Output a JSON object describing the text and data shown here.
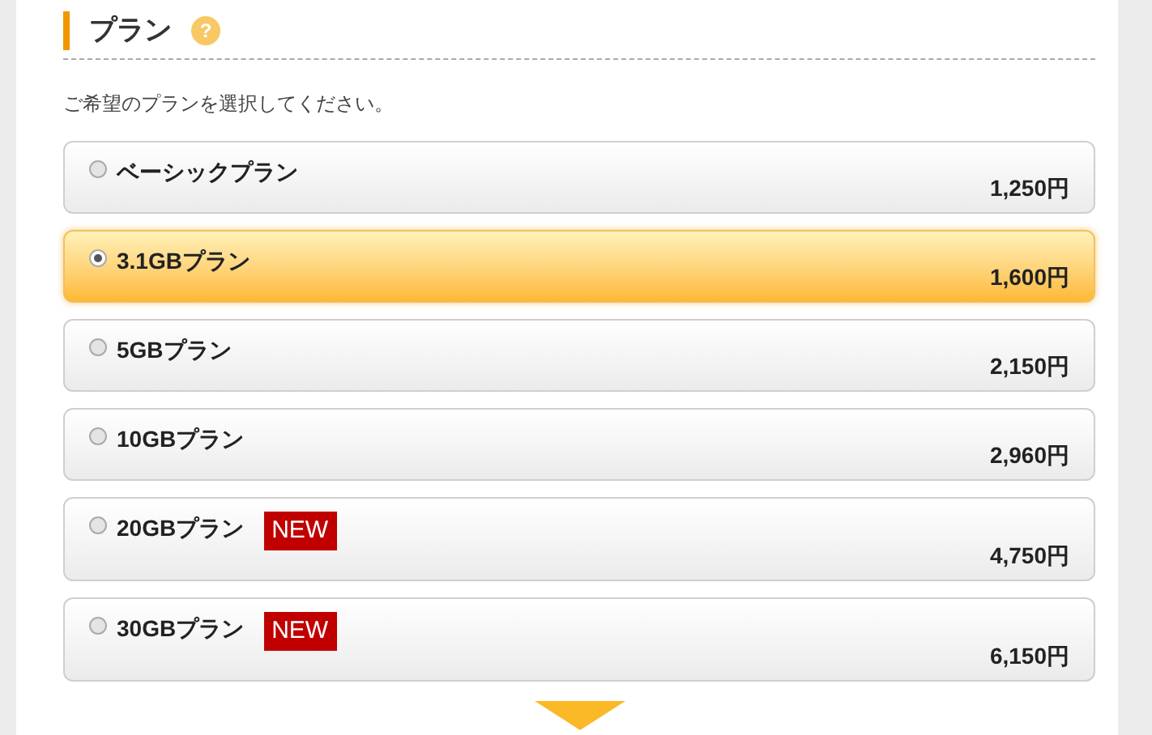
{
  "section": {
    "title": "プラン",
    "help": "?"
  },
  "instruction": "ご希望のプランを選択してください。",
  "plans": [
    {
      "name": "ベーシックプラン",
      "price": "1,250円",
      "selected": false
    },
    {
      "name": "3.1GBプラン",
      "price": "1,600円",
      "selected": true
    },
    {
      "name": "5GBプラン",
      "price": "2,150円",
      "selected": false
    },
    {
      "name": "10GBプラン",
      "price": "2,960円",
      "selected": false
    },
    {
      "name": "20GBプラン",
      "price": "4,750円",
      "selected": false,
      "badge": "NEW"
    },
    {
      "name": "30GBプラン",
      "price": "6,150円",
      "selected": false,
      "badge": "NEW"
    }
  ]
}
